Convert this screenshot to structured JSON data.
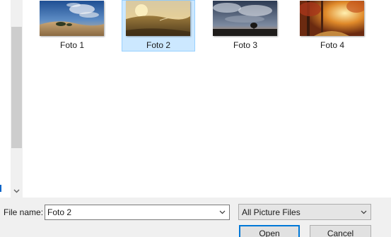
{
  "gallery": {
    "items": [
      {
        "label": "Foto 1",
        "selected": false,
        "icon": "landscape-thumbnail"
      },
      {
        "label": "Foto 2",
        "selected": true,
        "icon": "landscape-thumbnail"
      },
      {
        "label": "Foto 3",
        "selected": false,
        "icon": "landscape-thumbnail"
      },
      {
        "label": "Foto 4",
        "selected": false,
        "icon": "landscape-thumbnail"
      }
    ]
  },
  "footer": {
    "filename_label": "File name:",
    "filename_value": "Foto 2",
    "filter_value": "All Picture Files",
    "open_label": "Open",
    "cancel_label": "Cancel"
  },
  "colors": {
    "selection_fill": "#cce8ff",
    "selection_border": "#99d1ff",
    "default_button_border": "#0078d7"
  }
}
